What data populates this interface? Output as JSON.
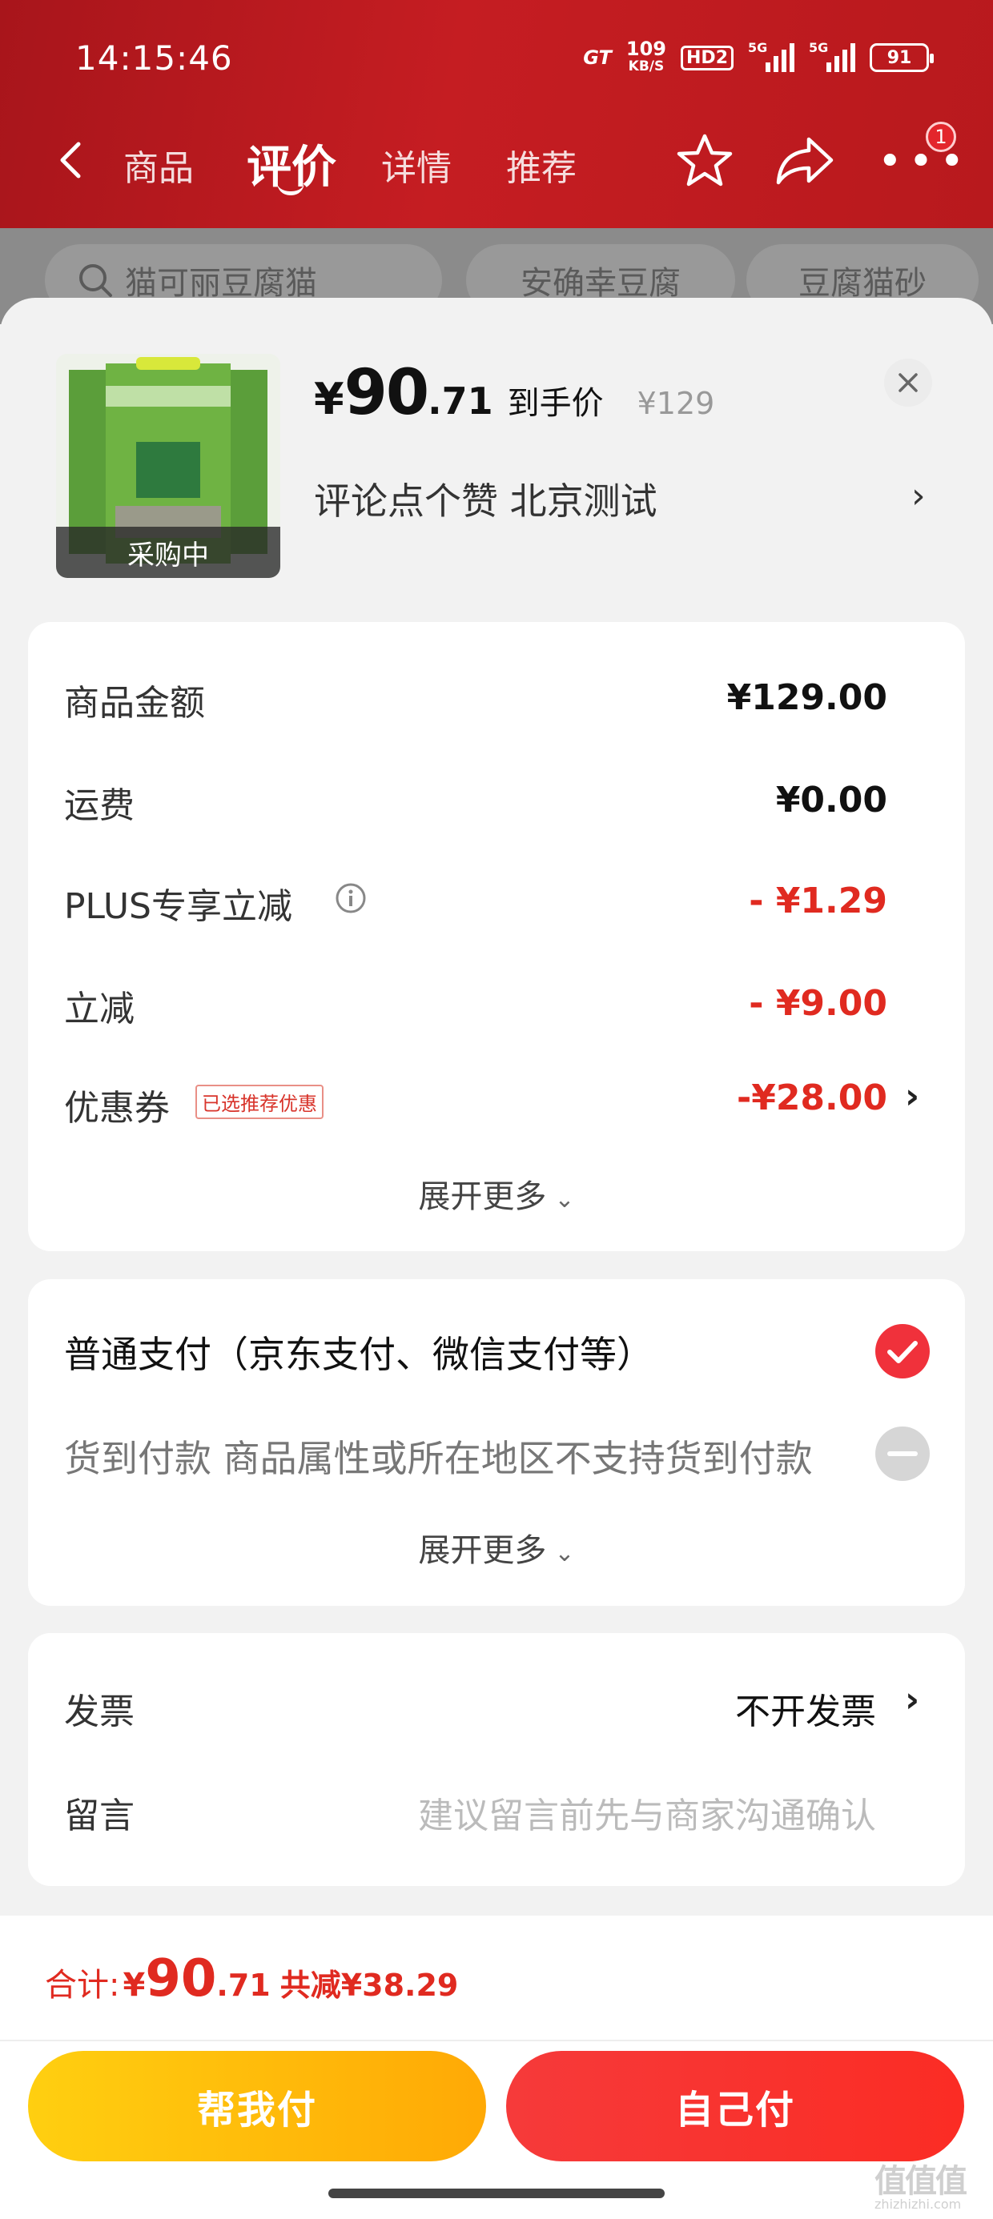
{
  "status_bar": {
    "time": "14:15:46",
    "network_brand": "GT",
    "speed_value": "109",
    "speed_unit": "KB/S",
    "hd_label": "HD2",
    "signal_1_label": "5G",
    "signal_2_label": "5G",
    "battery": "91"
  },
  "nav": {
    "tabs": [
      {
        "label": "商品"
      },
      {
        "label": "评价"
      },
      {
        "label": "详情"
      },
      {
        "label": "推荐"
      }
    ],
    "active_tab": "评价",
    "cart_badge": "1"
  },
  "search_chips": [
    {
      "label": "猫可丽豆腐猫"
    },
    {
      "label": "安确幸豆腐"
    },
    {
      "label": "豆腐猫砂"
    }
  ],
  "product": {
    "status_label": "采购中",
    "price_symbol": "¥",
    "price_int": "90",
    "price_dec": ".71",
    "price_label": "到手价",
    "original_price": "¥129",
    "promo_text": "评论点个赞  北京测试"
  },
  "fees": {
    "goods_amount": {
      "label": "商品金额",
      "value": "¥129.00"
    },
    "shipping": {
      "label": "运费",
      "value": "¥0.00"
    },
    "plus": {
      "label": "PLUS专享立减",
      "value": "- ¥1.29"
    },
    "instant": {
      "label": "立减",
      "value": "- ¥9.00"
    },
    "coupon": {
      "label": "优惠券",
      "tag": "已选推荐优惠",
      "value": "-¥28.00"
    },
    "expand_label": "展开更多"
  },
  "payment": {
    "normal": "普通支付（京东支付、微信支付等）",
    "cod": "货到付款 商品属性或所在地区不支持货到付款",
    "expand_label": "展开更多"
  },
  "extras": {
    "invoice_label": "发票",
    "invoice_value": "不开发票",
    "message_label": "留言",
    "message_placeholder": "建议留言前先与商家沟通确认"
  },
  "footer": {
    "total_label": "合计:",
    "total_yen": "¥",
    "total_int": "90",
    "total_dec": ".71",
    "discount": "共减¥38.29",
    "help_pay": "帮我付",
    "self_pay": "自己付"
  },
  "watermark": {
    "mark": "值值值",
    "domain": "zhizhizhi.com"
  },
  "colors": {
    "brand_red": "#e02a20",
    "header_red": "#c51d22",
    "help_yellow": "#ffb908"
  }
}
